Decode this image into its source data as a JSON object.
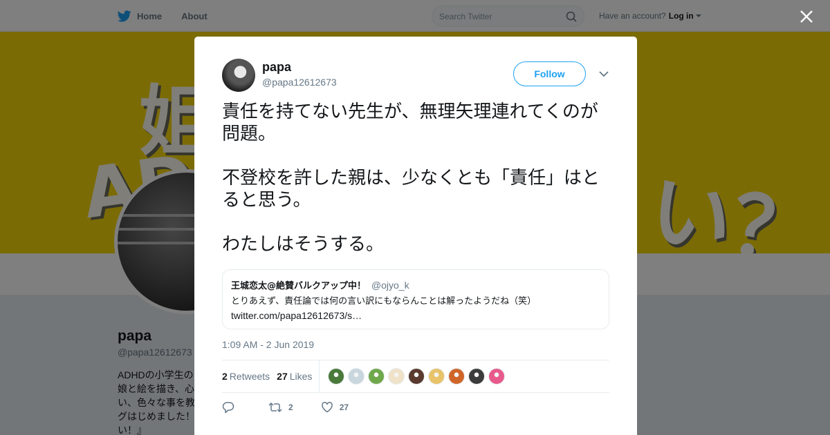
{
  "topbar": {
    "home_label": "Home",
    "about_label": "About",
    "search_placeholder": "Search Twitter",
    "account_prompt": "Have an account?",
    "login_label": "Log in"
  },
  "profile": {
    "name": "papa",
    "handle": "@papa12612673",
    "bio": "ADHDの小学生の\n娘と絵を描き、心\nい、色々な事を教\nグはじめました！\nい！』"
  },
  "banner": {
    "scribble_1": "姐",
    "scribble_2": "ADH",
    "scribble_3": "い？"
  },
  "tweet": {
    "author_name": "papa",
    "author_handle": "@papa12612673",
    "follow_label": "Follow",
    "paragraphs": [
      "責任を持てない先生が、無理矢理連れてくのが問題。",
      "不登校を許した親は、少なくとも「責任」はとると思う。",
      "わたしはそうする。"
    ],
    "quote": {
      "name": "王城恋太@絶賛バルクアップ中！",
      "handle": "@ojyo_k",
      "text": "とりあえず、責任論では何の言い訳にもならんことは解ったようだね（笑）",
      "link": "twitter.com/papa12612673/s…"
    },
    "timestamp": "1:09 AM - 2 Jun 2019",
    "retweets_count": "2",
    "retweets_label": "Retweets",
    "likes_count": "27",
    "likes_label": "Likes",
    "action_retweet_count": "2",
    "action_like_count": "27"
  },
  "likers": [
    {
      "icon": "liker-avatar",
      "color": "#4a7a3a"
    },
    {
      "icon": "liker-avatar",
      "color": "#c9d6de"
    },
    {
      "icon": "liker-avatar",
      "color": "#6fa84a"
    },
    {
      "icon": "liker-avatar",
      "color": "#f0e2c8"
    },
    {
      "icon": "liker-avatar",
      "color": "#5a3a2e"
    },
    {
      "icon": "liker-avatar",
      "color": "#e8c36a"
    },
    {
      "icon": "liker-avatar",
      "color": "#d0652a"
    },
    {
      "icon": "liker-avatar",
      "color": "#3c3c3c"
    },
    {
      "icon": "liker-avatar",
      "color": "#e85a8c"
    }
  ],
  "colors": {
    "accent": "#1da1f2",
    "banner": "#f7d70a",
    "overlay": "rgba(0,0,0,0.5)"
  }
}
